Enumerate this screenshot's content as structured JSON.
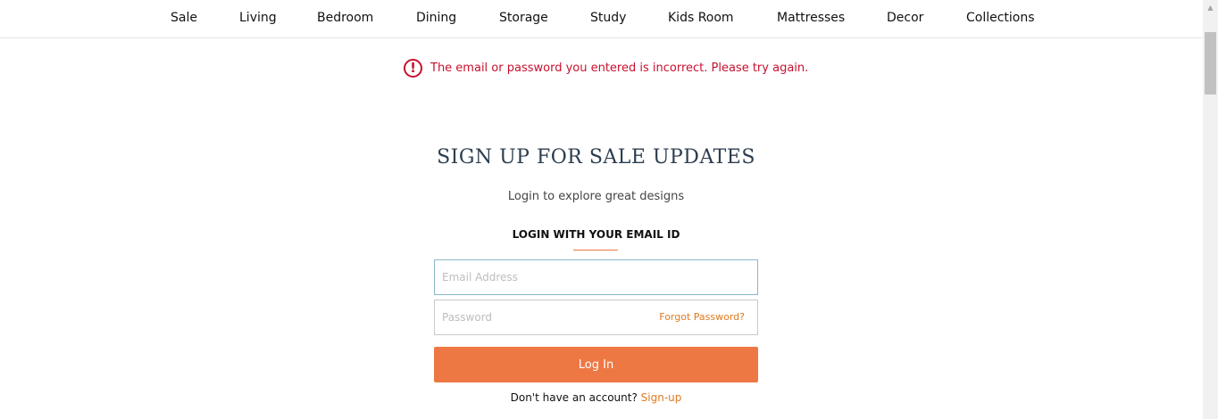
{
  "nav": {
    "items": [
      {
        "label": "Sale"
      },
      {
        "label": "Living"
      },
      {
        "label": "Bedroom"
      },
      {
        "label": "Dining"
      },
      {
        "label": "Storage"
      },
      {
        "label": "Study"
      },
      {
        "label": "Kids Room"
      },
      {
        "label": "Mattresses"
      },
      {
        "label": "Decor"
      },
      {
        "label": "Collections"
      }
    ]
  },
  "error": {
    "icon": "exclamation-circle-icon",
    "message": "The email or password you entered is incorrect. Please try again."
  },
  "login": {
    "title": "SIGN UP FOR SALE UPDATES",
    "subtitle": "Login to explore great designs",
    "heading": "LOGIN WITH YOUR EMAIL ID",
    "email_placeholder": "Email Address",
    "email_value": "",
    "password_placeholder": "Password",
    "password_value": "",
    "forgot_label": "Forgot Password?",
    "button_label": "Log In",
    "no_account_text": "Don't have an account?",
    "signup_label": "Sign-up"
  },
  "colors": {
    "accent": "#ee7844",
    "link": "#e07a1f",
    "error": "#c8102e",
    "title": "#2c3e50"
  }
}
